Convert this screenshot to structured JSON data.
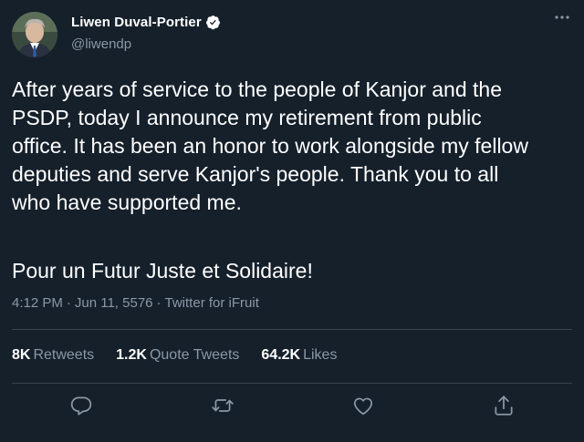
{
  "author": {
    "display_name": "Liwen Duval-Portier",
    "handle": "@liwendp",
    "verified_icon": "verified-badge-icon"
  },
  "tweet": {
    "text": "After years of service to the people of Kanjor and the\nPSDP, today I announce my retirement from public\noffice. It has been an honor to work alongside my fellow\ndeputies and serve Kanjor's people. Thank you to all\nwho have supported me.",
    "slogan": "Pour un Futur Juste et Solidaire!",
    "time": "4:12 PM",
    "date": "Jun 11, 5576",
    "source": "Twitter for iFruit",
    "separator": "·"
  },
  "stats": {
    "retweets_count": "8K",
    "retweets_label": "Retweets",
    "quote_count": "1.2K",
    "quote_label": "Quote Tweets",
    "likes_count": "64.2K",
    "likes_label": "Likes"
  },
  "colors": {
    "background": "#15202b",
    "secondary_text": "#8b98a5",
    "divider": "#38444d",
    "verified": "#ffffff"
  },
  "icons": [
    "more-options-icon",
    "reply-icon",
    "retweet-icon",
    "like-icon",
    "share-icon"
  ]
}
